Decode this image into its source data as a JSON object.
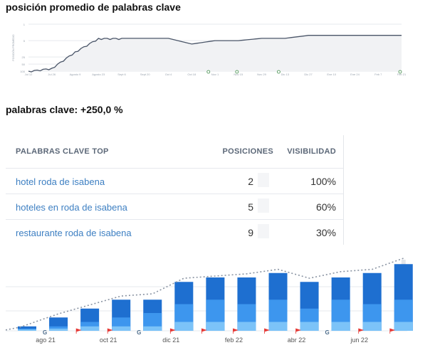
{
  "heading_top": "posición promedio de palabras clave",
  "heading_mid": "palabras clave: +250,0 %",
  "table": {
    "headers": {
      "keyword": "PALABRAS CLAVE TOP",
      "positions": "POSICIONES",
      "visibility": "VISIBILIDAD"
    },
    "rows": [
      {
        "keyword": "hotel roda de isabena",
        "position": "2",
        "visibility": "100%"
      },
      {
        "keyword": "hoteles en roda de isabena",
        "position": "5",
        "visibility": "60%"
      },
      {
        "keyword": "restaurante roda de isabena",
        "position": "9",
        "visibility": "30%"
      }
    ]
  },
  "colors": {
    "line": "#4a5568",
    "bar_dark": "#1e6fd0",
    "bar_mid": "#3d96ee",
    "bar_light": "#7cc3f8",
    "dotted": "#8a94a3",
    "flag": "#e53935"
  },
  "chart_data": [
    {
      "type": "area",
      "ylabel": "POSICIÓN PROMEDIO",
      "yticks": [
        "1",
        "5",
        "25",
        "50",
        "100"
      ],
      "ylim": [
        100,
        1
      ],
      "x": [
        "Jul 12",
        "Jul 26",
        "Agosto 9",
        "Agosto 23",
        "Sept 6",
        "Sept 20",
        "Oct 4",
        "Oct 18",
        "Nov 1",
        "Nov 15",
        "Nov 29",
        "Dic 13",
        "Dic 27",
        "Ene 10",
        "Ene 24",
        "Feb 7",
        "Feb 21"
      ],
      "series": [
        {
          "values": [
            100,
            75,
            15,
            4,
            4,
            4,
            4,
            7,
            5,
            5,
            4,
            4,
            3,
            3,
            3,
            3,
            3
          ]
        }
      ],
      "markers": [
        "G",
        "G",
        "G",
        "G"
      ]
    },
    {
      "type": "bar",
      "categories": [
        "",
        "ago 21",
        "",
        "oct 21",
        "",
        "dic 21",
        "",
        "feb 22",
        "",
        "abr 22",
        "",
        "jun 22",
        ""
      ],
      "series": [
        {
          "values": [
            1,
            3,
            5,
            7,
            7,
            11,
            12,
            12,
            13,
            11,
            12,
            13,
            15
          ]
        },
        {
          "values": [
            0.5,
            1,
            2,
            3,
            4,
            6,
            7,
            6,
            7,
            5,
            7,
            6,
            7
          ]
        },
        {
          "values": [
            0.3,
            0.5,
            1,
            1,
            1,
            2,
            2,
            2,
            2,
            2,
            2,
            2,
            2
          ]
        }
      ],
      "trend": [
        0.5,
        3.5,
        5.5,
        7.5,
        8,
        11.5,
        12,
        12.5,
        13.5,
        11.5,
        13,
        13.5,
        16
      ],
      "event_markers": [
        "",
        "G",
        "P",
        "P",
        "G",
        "P",
        "P",
        "P",
        "P",
        "P",
        "G",
        "P",
        "P"
      ],
      "ylim": [
        0,
        16
      ]
    }
  ]
}
